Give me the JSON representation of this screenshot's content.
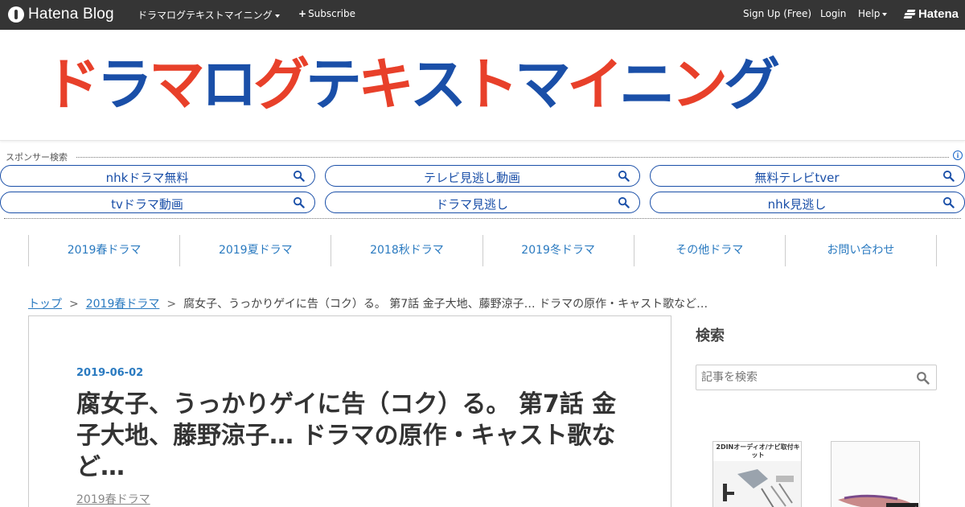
{
  "topbar": {
    "logo_text": "Hatena Blog",
    "blog_menu": "ドラマログテキストマイニング",
    "subscribe": "Subscribe",
    "signup": "Sign Up (Free)",
    "login": "Login",
    "help": "Help",
    "brand": "Hatena"
  },
  "header": {
    "banner_text": "ドラマログテキストマイニング",
    "colors": {
      "red": "#e8402a",
      "blue": "#1a4fa8"
    }
  },
  "sponsor": {
    "label": "スポンサー検索",
    "info": "i",
    "pills": [
      "nhkドラマ無料",
      "テレビ見逃し動画",
      "無料テレビtver",
      "tvドラマ動画",
      "ドラマ見逃し",
      "nhk見逃し"
    ]
  },
  "nav": {
    "items": [
      "2019春ドラマ",
      "2019夏ドラマ",
      "2018秋ドラマ",
      "2019冬ドラマ",
      "その他ドラマ",
      "お問い合わせ"
    ]
  },
  "breadcrumb": {
    "top": "トップ",
    "category": "2019春ドラマ",
    "sep1": ">",
    "sep2": ">",
    "current": "腐女子、うっかりゲイに告（コク）る。 第7話 金子大地、藤野涼子… ドラマの原作・キャスト歌など…"
  },
  "article": {
    "date": "2019-06-02",
    "title": "腐女子、うっかりゲイに告（コク）る。 第7話 金子大地、藤野涼子… ドラマの原作・キャスト歌など…",
    "category": "2019春ドラマ"
  },
  "sidebar": {
    "heading": "検索",
    "search_placeholder": "記事を検索",
    "ad1_text": "2DINオーディオ/ナビ取付キット"
  }
}
